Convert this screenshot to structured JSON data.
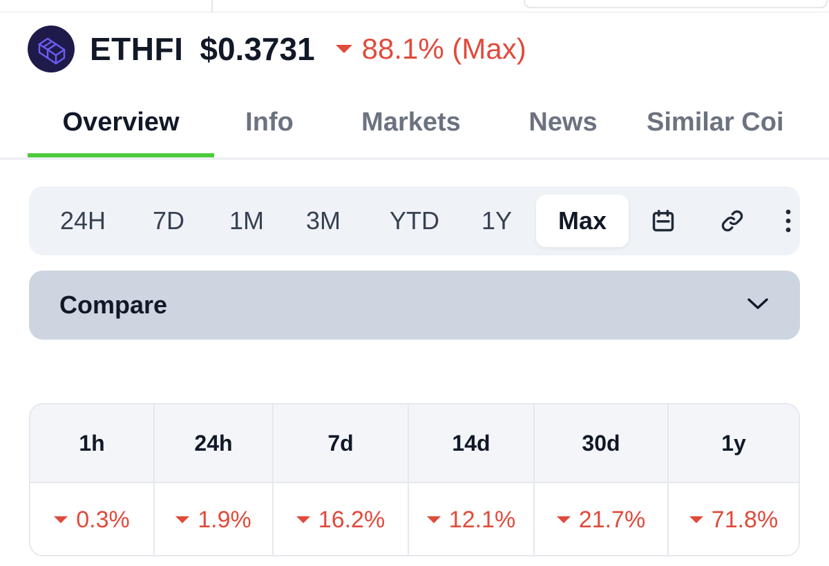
{
  "coin": {
    "symbol": "ETHFI",
    "price": "$0.3731",
    "change": "88.1% (Max)"
  },
  "tabs": [
    {
      "label": "Overview",
      "active": true
    },
    {
      "label": "Info",
      "active": false
    },
    {
      "label": "Markets",
      "active": false
    },
    {
      "label": "News",
      "active": false
    },
    {
      "label": "Similar Coi",
      "active": false
    }
  ],
  "timeframes": [
    {
      "label": "24H"
    },
    {
      "label": "7D"
    },
    {
      "label": "1M"
    },
    {
      "label": "3M"
    },
    {
      "label": "YTD"
    },
    {
      "label": "1Y"
    },
    {
      "label": "Max",
      "active": true
    }
  ],
  "toolbar_icons": [
    "calendar-icon",
    "link-icon",
    "more-vertical-icon"
  ],
  "compare": {
    "label": "Compare"
  },
  "stats": [
    {
      "period": "1h",
      "value": "0.3%"
    },
    {
      "period": "24h",
      "value": "1.9%"
    },
    {
      "period": "7d",
      "value": "16.2%"
    },
    {
      "period": "14d",
      "value": "12.1%"
    },
    {
      "period": "30d",
      "value": "21.7%"
    },
    {
      "period": "1y",
      "value": "71.8%"
    }
  ],
  "colors": {
    "negative": "#e04a3b",
    "active_tab_underline": "#4bcc3b",
    "logo_bg": "#1e1b4b"
  }
}
